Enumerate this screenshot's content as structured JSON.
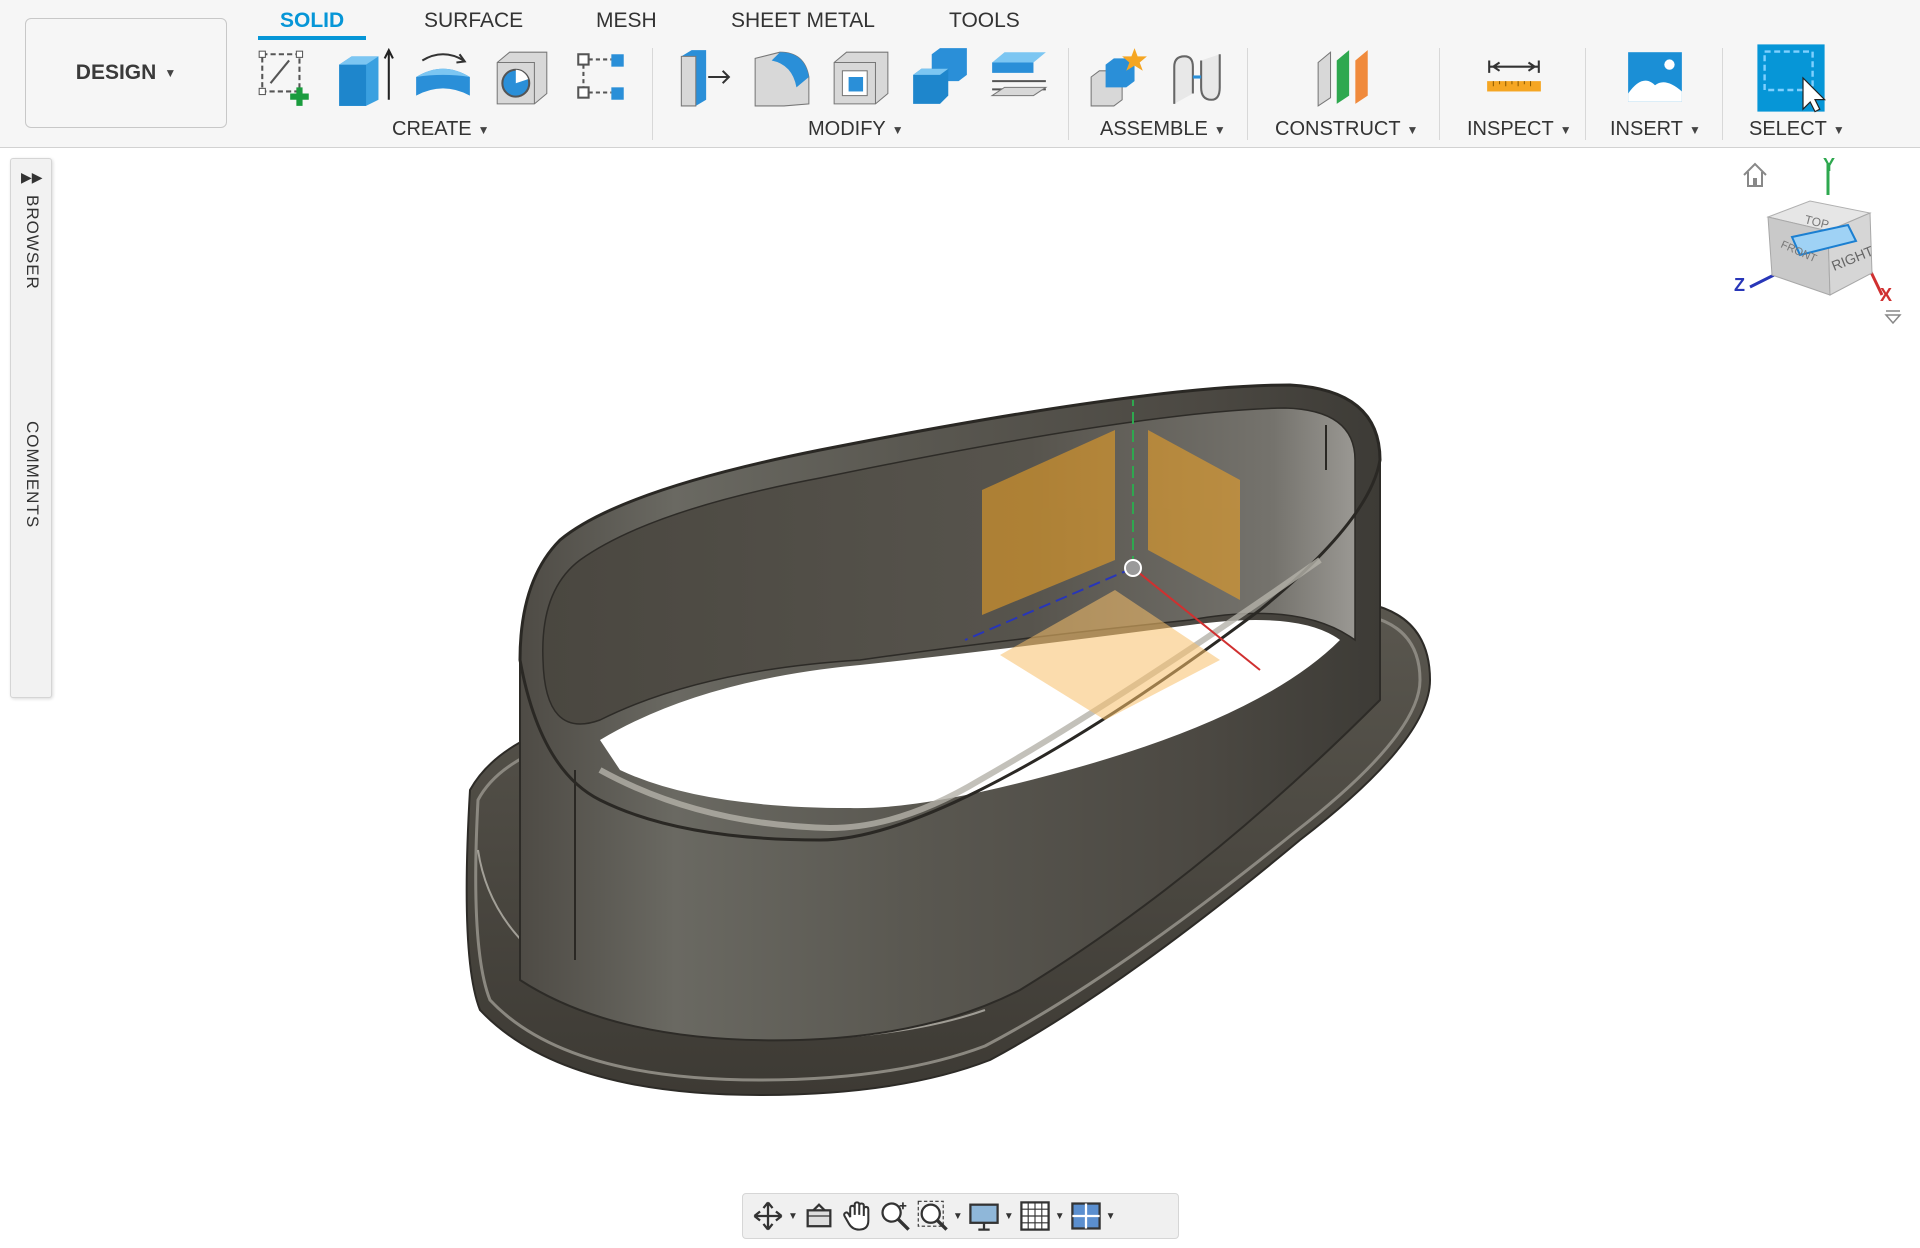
{
  "workspace": {
    "label": "DESIGN"
  },
  "tabs": [
    {
      "label": "SOLID",
      "active": true
    },
    {
      "label": "SURFACE"
    },
    {
      "label": "MESH"
    },
    {
      "label": "SHEET METAL"
    },
    {
      "label": "TOOLS"
    }
  ],
  "groups": {
    "create": "CREATE",
    "modify": "MODIFY",
    "assemble": "ASSEMBLE",
    "construct": "CONSTRUCT",
    "inspect": "INSPECT",
    "insert": "INSERT",
    "select": "SELECT"
  },
  "side_panel": {
    "browser": "BROWSER",
    "comments": "COMMENTS"
  },
  "viewcube": {
    "top": "TOP",
    "right": "RIGHT",
    "front": "FRONT",
    "x_axis": "X",
    "y_axis": "Y",
    "z_axis": "Z"
  },
  "colors": {
    "accent": "#0696d7",
    "model": "#5d5a54",
    "origin_plane": "#f5a623"
  },
  "icons": {
    "create": [
      "sketch-icon",
      "extrude-icon",
      "revolve-icon",
      "hole-icon",
      "pattern-icon"
    ],
    "modify": [
      "press-pull-icon",
      "fillet-icon",
      "shell-icon",
      "combine-icon",
      "offset-face-icon"
    ],
    "assemble": [
      "new-component-icon",
      "joint-icon"
    ],
    "construct": [
      "plane-icon"
    ],
    "inspect": [
      "measure-icon"
    ],
    "insert": [
      "insert-image-icon"
    ],
    "select": [
      "select-icon"
    ],
    "navbar": [
      "orbit-icon",
      "look-at-icon",
      "pan-icon",
      "zoom-icon",
      "fit-icon",
      "display-settings-icon",
      "grid-icon",
      "viewports-icon"
    ]
  }
}
